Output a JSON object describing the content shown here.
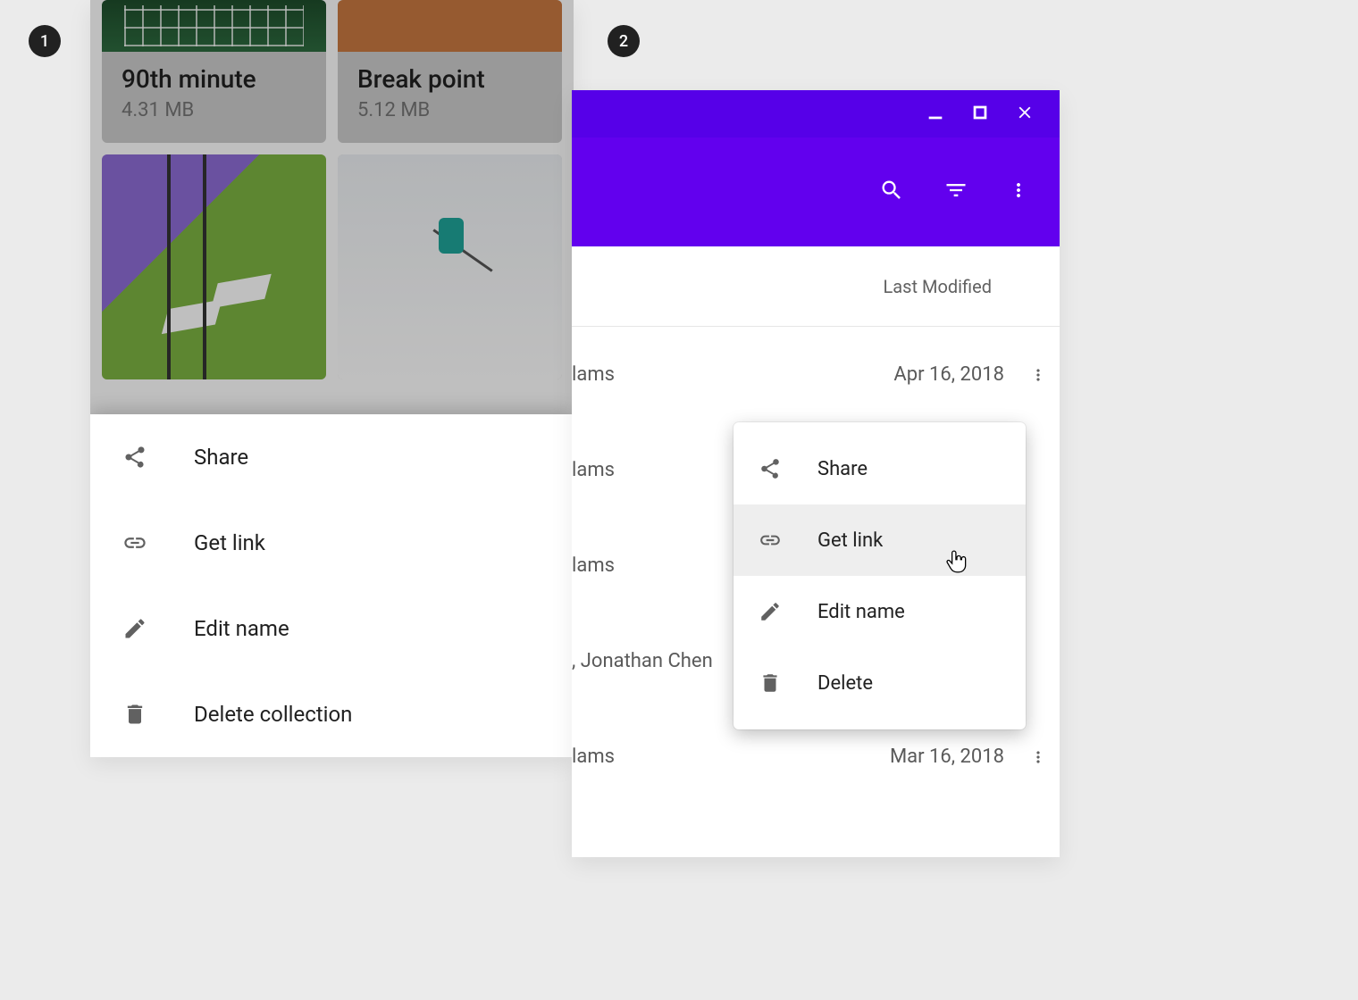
{
  "badges": {
    "one": "1",
    "two": "2"
  },
  "panel1": {
    "cards": [
      {
        "title": "90th minute",
        "size": "4.31 MB"
      },
      {
        "title": "Break point",
        "size": "5.12 MB"
      }
    ],
    "sheet": {
      "share": "Share",
      "get_link": "Get link",
      "edit_name": "Edit name",
      "delete": "Delete collection"
    }
  },
  "panel2": {
    "header": {
      "last_modified": "Last Modified"
    },
    "rows": [
      {
        "owner_fragment": "lams",
        "date": "Apr 16, 2018"
      },
      {
        "owner_fragment": "lams",
        "date": ""
      },
      {
        "owner_fragment": "lams",
        "date": ""
      },
      {
        "owner_fragment": ", Jonathan Chen",
        "date": ""
      },
      {
        "owner_fragment": "lams",
        "date": "Mar 16, 2018"
      }
    ],
    "menu": {
      "share": "Share",
      "get_link": "Get link",
      "edit_name": "Edit name",
      "delete": "Delete"
    }
  }
}
